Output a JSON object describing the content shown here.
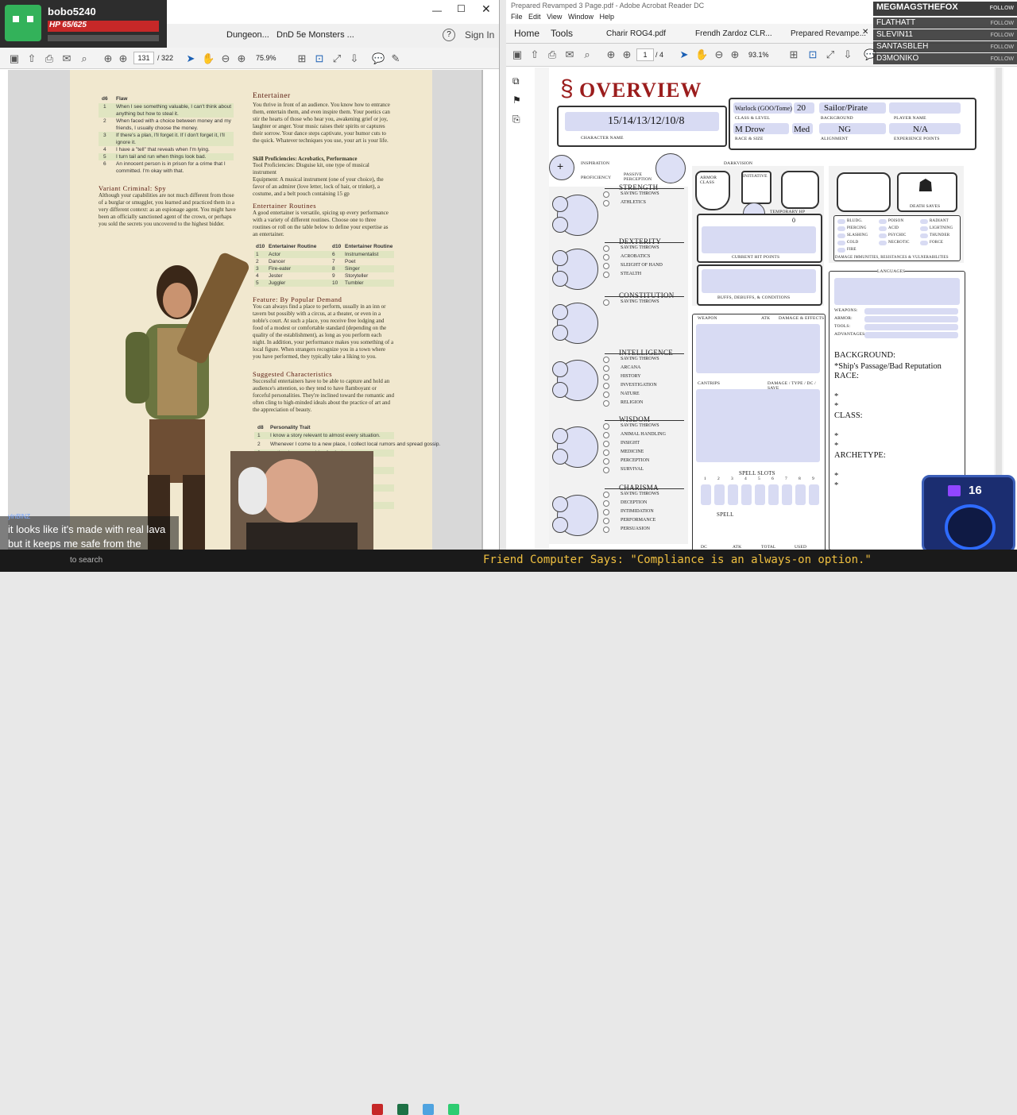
{
  "viewer": {
    "username": "bobo5240",
    "hp": "HP 65/625"
  },
  "left_window": {
    "tabs": [
      "Dungeon...",
      "DnD 5e Monsters ..."
    ],
    "sign_in": "Sign In",
    "page_current": "131",
    "page_total": "/ 322",
    "zoom": "75.9%"
  },
  "phb": {
    "flaw_header": [
      "d6",
      "Flaw"
    ],
    "flaws": [
      [
        "1",
        "When I see something valuable, I can't think about anything but how to steal it."
      ],
      [
        "2",
        "When faced with a choice between money and my friends, I usually choose the money."
      ],
      [
        "3",
        "If there's a plan, I'll forget it. If I don't forget it, I'll ignore it."
      ],
      [
        "4",
        "I have a \"tell\" that reveals when I'm lying."
      ],
      [
        "5",
        "I turn tail and run when things look bad."
      ],
      [
        "6",
        "An innocent person is in prison for a crime that I committed. I'm okay with that."
      ]
    ],
    "variant_title": "Variant Criminal: Spy",
    "variant_text": "Although your capabilities are not much different from those of a burglar or smuggler, you learned and practiced them in a very different context: as an espionage agent. You might have been an officially sanctioned agent of the crown, or perhaps you sold the secrets you uncovered to the highest bidder.",
    "entertainer_title": "Entertainer",
    "entertainer_text": "You thrive in front of an audience. You know how to entrance them, entertain them, and even inspire them. Your poetics can stir the hearts of those who hear you, awakening grief or joy, laughter or anger. Your music raises their spirits or captures their sorrow. Your dance steps captivate, your humor cuts to the quick. Whatever techniques you use, your art is your life.",
    "skill_prof": "Skill Proficiencies: Acrobatics, Performance",
    "tool_prof": "Tool Proficiencies: Disguise kit, one type of musical instrument",
    "equipment": "Equipment: A musical instrument (one of your choice), the favor of an admirer (love letter, lock of hair, or trinket), a costume, and a belt pouch containing 15 gp",
    "routines_title": "Entertainer Routines",
    "routines_text": "A good entertainer is versatile, spicing up every performance with a variety of different routines. Choose one to three routines or roll on the table below to define your expertise as an entertainer.",
    "routine_header": [
      "d10",
      "Entertainer Routine",
      "d10",
      "Entertainer Routine"
    ],
    "routines": [
      [
        "1",
        "Actor",
        "6",
        "Instrumentalist"
      ],
      [
        "2",
        "Dancer",
        "7",
        "Poet"
      ],
      [
        "3",
        "Fire-eater",
        "8",
        "Singer"
      ],
      [
        "4",
        "Jester",
        "9",
        "Storyteller"
      ],
      [
        "5",
        "Juggler",
        "10",
        "Tumbler"
      ]
    ],
    "feature_title": "Feature: By Popular Demand",
    "feature_text": "You can always find a place to perform, usually in an inn or tavern but possibly with a circus, at a theater, or even in a noble's court. At such a place, you receive free lodging and food of a modest or comfortable standard (depending on the quality of the establishment), as long as you perform each night. In addition, your performance makes you something of a local figure. When strangers recognize you in a town where you have performed, they typically take a liking to you.",
    "suggested_title": "Suggested Characteristics",
    "suggested_text": "Successful entertainers have to be able to capture and hold an audience's attention, so they tend to have flamboyant or forceful personalities. They're inclined toward the romantic and often cling to high-minded ideals about the practice of art and the appreciation of beauty.",
    "trait_header": [
      "d8",
      "Personality Trait"
    ],
    "traits": [
      [
        "1",
        "I know a story relevant to almost every situation."
      ],
      [
        "2",
        "Whenever I come to a new place, I collect local rumors and spread gossip."
      ],
      [
        "3",
        "...ntic, always searching for that"
      ],
      [
        "4",
        "...t me or around me for long, since"
      ],
      [
        "5",
        "...unt of tension"
      ],
      [
        "6",
        "...even one directed at me."
      ],
      [
        "7",
        "...the center of attention."
      ],
      [
        "8",
        "...less than perfection."
      ],
      [
        "",
        "...my mind as quickly as I change"
      ]
    ]
  },
  "chat": {
    "user": "ylnBlNZ",
    "message": "it looks like it's made with real lava but it keeps me safe from the weather."
  },
  "right_window": {
    "title": "Prepared Revamped 3 Page.pdf - Adobe Acrobat Reader DC",
    "menu": [
      "File",
      "Edit",
      "View",
      "Window",
      "Help"
    ],
    "nav": [
      "Home",
      "Tools"
    ],
    "tabs": [
      "Charir ROG4.pdf",
      "Frendh Zardoz CLR...",
      "Prepared Revampe..."
    ],
    "page_current": "1",
    "page_total": "/ 4",
    "zoom": "93.1%"
  },
  "sheet": {
    "title": "OVERVIEW",
    "stats": "15/14/13/12/10/8",
    "character_name_label": "CHARACTER NAME",
    "class": "Warlock (GOO/Tome)",
    "level": "20",
    "class_label": "CLASS & LEVEL",
    "background": "Sailor/Pirate",
    "background_label": "BACKGROUND",
    "player_label": "PLAYER NAME",
    "race": "M Drow",
    "size": "Med",
    "race_label": "RACE & SIZE",
    "alignment": "NG",
    "alignment_label": "ALIGNMENT",
    "xp": "N/A",
    "xp_label": "EXPERIENCE POINTS",
    "inspiration": "INSPIRATION",
    "proficiency": "PROFICIENCY",
    "passive": "PASSIVE PERCEPTION",
    "darkvision": "DARKVISION",
    "armor_class": "ARMOR CLASS",
    "initiative": "INITIATIVE",
    "speed": "SPEED",
    "temp_hp": "TEMPORARY HP",
    "temp_hp_value": "0",
    "current_hp": "CURRENT HIT POINTS",
    "buffs": "BUFFS, DEBUFFS, & CONDITIONS",
    "death_saves": "DEATH SAVES",
    "damage_types": [
      [
        "BLUDG.",
        "POISON",
        "RADIANT"
      ],
      [
        "PIERCING",
        "ACID",
        "LIGHTNING"
      ],
      [
        "SLASHING",
        "PSYCHIC",
        "THUNDER"
      ],
      [
        "COLD",
        "NECROTIC",
        "FORCE"
      ],
      [
        "FIRE",
        "",
        ""
      ]
    ],
    "damage_label": "DAMAGE IMMUNITIES, RESISTANCES & VULNERABILITIES",
    "languages": "LANGUAGES",
    "proficiencies": [
      "WEAPONS:",
      "ARMOR:",
      "TOOLS:",
      "ADVANTAGES:"
    ],
    "abilities": [
      {
        "name": "STRENGTH",
        "skills": [
          "SAVING THROWS",
          "ATHLETICS"
        ]
      },
      {
        "name": "DEXTERITY",
        "skills": [
          "SAVING THROWS",
          "ACROBATICS",
          "SLEIGHT OF HAND",
          "STEALTH"
        ]
      },
      {
        "name": "CONSTITUTION",
        "skills": [
          "SAVING THROWS"
        ]
      },
      {
        "name": "INTELLIGENCE",
        "skills": [
          "SAVING THROWS",
          "ARCANA",
          "HISTORY",
          "INVESTIGATION",
          "NATURE",
          "RELIGION"
        ]
      },
      {
        "name": "WISDOM",
        "skills": [
          "SAVING THROWS",
          "ANIMAL HANDLING",
          "INSIGHT",
          "MEDICINE",
          "PERCEPTION",
          "SURVIVAL"
        ]
      },
      {
        "name": "CHARISMA",
        "skills": [
          "SAVING THROWS",
          "DECEPTION",
          "INTIMIDATION",
          "PERFORMANCE",
          "PERSUASION"
        ]
      }
    ],
    "weapon_headers": [
      "WEAPON",
      "ATK",
      "DAMAGE & EFFECTS"
    ],
    "cantrip_headers": [
      "CANTRIPS",
      "DAMAGE / TYPE / DC / SAVE"
    ],
    "spell_slots": "SPELL SLOTS",
    "spell_slot_numbers": [
      "1",
      "2",
      "3",
      "4",
      "5",
      "6",
      "7",
      "8",
      "9"
    ],
    "spell": "SPELL",
    "spell_footer": [
      "DC",
      "ATK",
      "TOTAL",
      "USED"
    ],
    "notes": [
      "BACKGROUND:",
      "*Ship's Passage/Bad Reputation",
      "RACE:",
      "*",
      "*",
      "CLASS:",
      "*",
      "*",
      "ARCHETYPE:",
      "*",
      "*"
    ]
  },
  "follow_list": {
    "title": "MEGMAGSTHEFOX",
    "names": [
      "FLATHATT",
      "SLEVIN11",
      "SANTASBLEH",
      "D3MONIKO"
    ],
    "follow": "FOLLOW"
  },
  "counter": "16",
  "ticker": "Friend Computer Says: \"Compliance is an always-on option.\"",
  "taskbar_search": "to search"
}
